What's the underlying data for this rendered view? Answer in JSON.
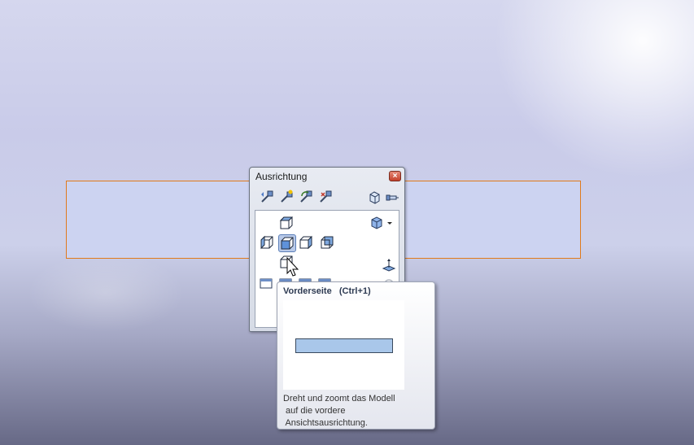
{
  "panel": {
    "title": "Ausrichtung",
    "close_glyph": "×"
  },
  "toolbar": {
    "buttons": [
      {
        "name": "previous-view-icon"
      },
      {
        "name": "new-view-icon"
      },
      {
        "name": "update-standard-views-icon"
      },
      {
        "name": "reset-standard-views-icon"
      },
      {
        "name": "view-selector-icon"
      },
      {
        "name": "pin-dialog-icon"
      }
    ]
  },
  "views": {
    "grid": [
      "oben",
      "vorderseite",
      "links",
      "rechts",
      "hinten",
      "unten"
    ],
    "selected": "vorderseite"
  },
  "tooltip": {
    "title": "Vorderseite   (Ctrl+1)",
    "description_lines": [
      "Dreht und zoomt das Modell",
      " auf die vordere",
      " Ansichtsausrichtung."
    ]
  },
  "colors": {
    "model_border": "#e07a1c",
    "model_fill": "#ccd3f1",
    "preview_fill": "#a9c7ea"
  }
}
